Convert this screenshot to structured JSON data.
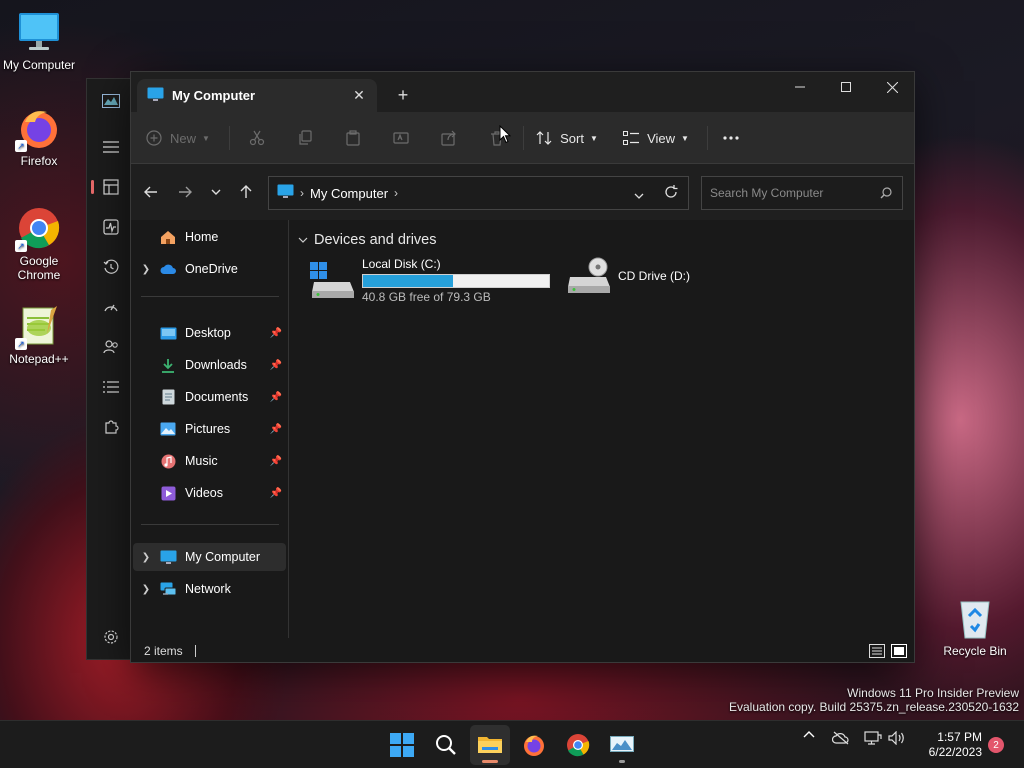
{
  "desktop": {
    "icons": [
      {
        "label": "My Computer"
      },
      {
        "label": "Firefox"
      },
      {
        "label": "Google Chrome"
      },
      {
        "label": "Notepad++"
      },
      {
        "label": "Recycle Bin"
      }
    ]
  },
  "window": {
    "tab_title": "My Computer",
    "toolbar": {
      "new_label": "New",
      "sort_label": "Sort",
      "view_label": "View"
    },
    "address": {
      "segment": "My Computer"
    },
    "search": {
      "placeholder": "Search My Computer"
    },
    "nav": {
      "home": "Home",
      "onedrive": "OneDrive",
      "quick": [
        "Desktop",
        "Downloads",
        "Documents",
        "Pictures",
        "Music",
        "Videos"
      ],
      "mycomputer": "My Computer",
      "network": "Network"
    },
    "content": {
      "group_title": "Devices and drives",
      "drives": [
        {
          "name": "Local Disk (C:)",
          "free_text": "40.8 GB free of 79.3 GB",
          "used_fraction": 0.486
        },
        {
          "name": "CD Drive (D:)"
        }
      ]
    },
    "status": {
      "items": "2 items"
    }
  },
  "watermark": {
    "line1": "Windows 11 Pro Insider Preview",
    "line2": "Evaluation copy. Build 25375.zn_release.230520-1632"
  },
  "taskbar": {
    "time": "1:57 PM",
    "date": "6/22/2023",
    "notification_count": "2"
  },
  "colors": {
    "accent": "#26a0da",
    "window_bg": "#191919",
    "toolbar_bg": "#2b2b2b",
    "badge": "#e3566c"
  }
}
